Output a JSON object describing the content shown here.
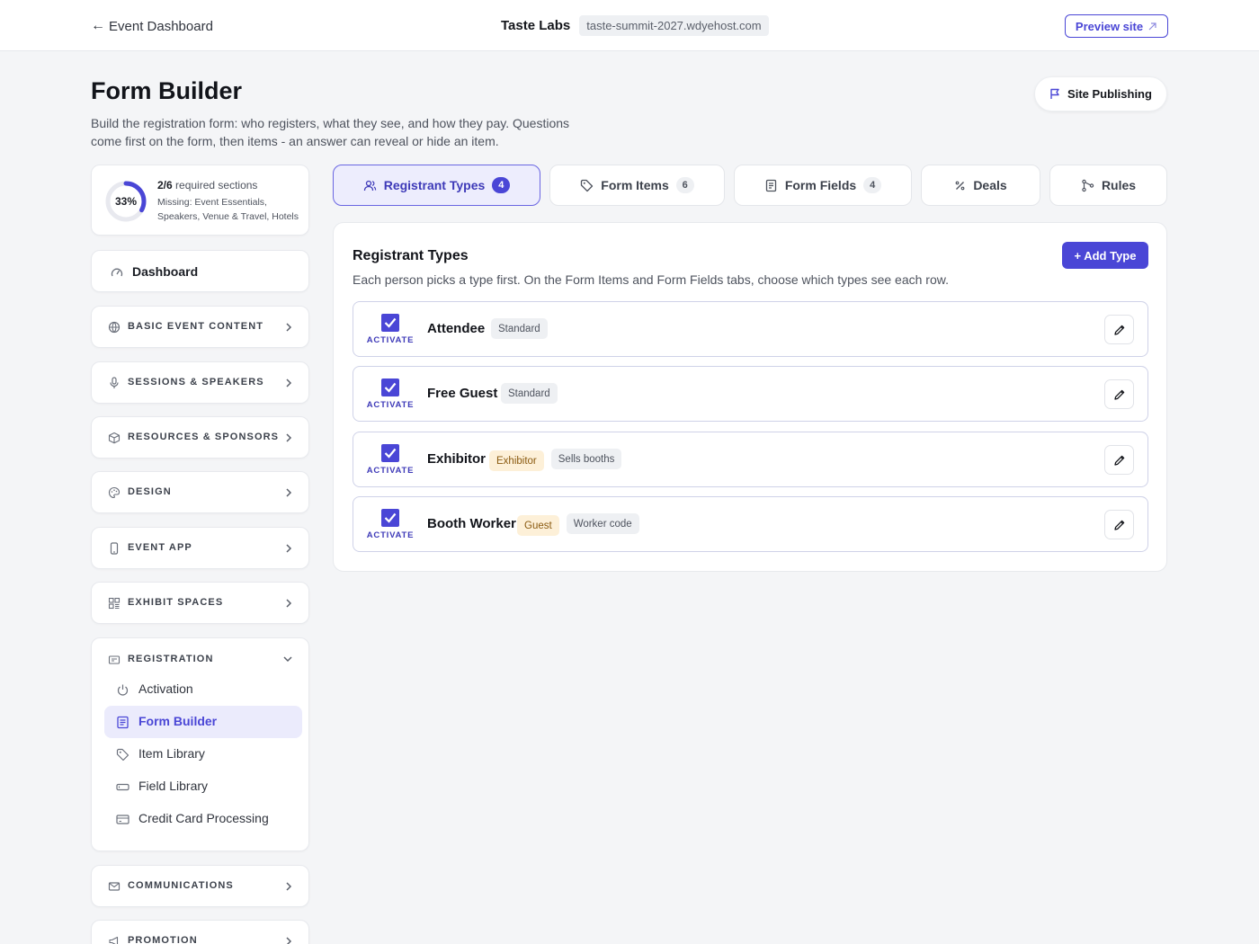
{
  "topbar": {
    "back_label": "Event Dashboard",
    "org_name": "Taste Labs",
    "site_domain": "taste-summit-2027.wdyehost.com",
    "preview_label": "Preview site"
  },
  "header": {
    "title": "Form Builder",
    "description": "Build the registration form: who registers, what they see, and how they pay. Questions come first on the form, then items - an answer can reveal or hide an item.",
    "publish_label": "Site Publishing"
  },
  "progress": {
    "percent_label": "33%",
    "percent": 33,
    "count": "2/6",
    "suffix": "required sections",
    "missing": "Missing: Event Essentials, Speakers, Venue & Travel, Hotels"
  },
  "sidebar": {
    "dashboard_label": "Dashboard",
    "sections": [
      {
        "label": "BASIC EVENT CONTENT",
        "icon": "globe-icon"
      },
      {
        "label": "SESSIONS & SPEAKERS",
        "icon": "microphone-icon"
      },
      {
        "label": "RESOURCES & SPONSORS",
        "icon": "box-icon"
      },
      {
        "label": "DESIGN",
        "icon": "palette-icon"
      },
      {
        "label": "EVENT APP",
        "icon": "phone-icon"
      },
      {
        "label": "EXHIBIT SPACES",
        "icon": "grid-icon"
      }
    ],
    "registration": {
      "label": "REGISTRATION",
      "items": [
        {
          "label": "Activation",
          "icon": "power-icon"
        },
        {
          "label": "Form Builder",
          "icon": "form-icon",
          "active": true
        },
        {
          "label": "Item Library",
          "icon": "tag-icon"
        },
        {
          "label": "Field Library",
          "icon": "field-icon"
        },
        {
          "label": "Credit Card Processing",
          "icon": "credit-card-icon"
        }
      ]
    },
    "after_sections": [
      {
        "label": "COMMUNICATIONS",
        "icon": "mail-icon"
      },
      {
        "label": "PROMOTION",
        "icon": "megaphone-icon"
      }
    ]
  },
  "tabs": [
    {
      "label": "Registrant Types",
      "count": "4",
      "icon": "users-icon",
      "active": true
    },
    {
      "label": "Form Items",
      "count": "6",
      "icon": "tag-icon"
    },
    {
      "label": "Form Fields",
      "count": "4",
      "icon": "document-icon"
    },
    {
      "label": "Deals",
      "count": "",
      "icon": "percent-icon"
    },
    {
      "label": "Rules",
      "count": "",
      "icon": "branch-icon"
    }
  ],
  "panel": {
    "title": "Registrant Types",
    "description": "Each person picks a type first. On the Form Items and Form Fields tabs, choose which types see each row.",
    "add_label": "+ Add Type",
    "activate_label": "ACTIVATE",
    "types": [
      {
        "name": "Attendee",
        "checked": true,
        "tags": [
          {
            "text": "Standard",
            "style": "gray"
          }
        ]
      },
      {
        "name": "Free Guest",
        "checked": true,
        "tags": [
          {
            "text": "Standard",
            "style": "gray"
          }
        ]
      },
      {
        "name": "Exhibitor",
        "checked": true,
        "tags": [
          {
            "text": "Exhibitor",
            "style": "amber"
          },
          {
            "text": "Sells booths",
            "style": "gray"
          }
        ]
      },
      {
        "name": "Booth Worker",
        "checked": true,
        "tags": [
          {
            "text": "Guest",
            "style": "amber"
          },
          {
            "text": "Worker code",
            "style": "gray"
          }
        ]
      }
    ]
  },
  "colors": {
    "accent": "#4a46d6",
    "accent_soft": "#ededfd",
    "amber_tag": "#fdf0d8"
  }
}
